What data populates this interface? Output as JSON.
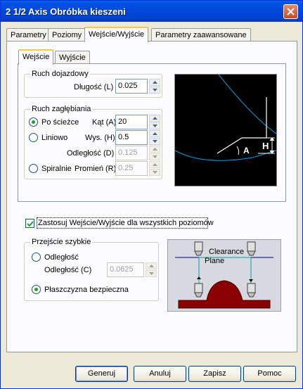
{
  "window": {
    "title": "2 1/2 Axis Obróbka kieszeni"
  },
  "tabs": [
    {
      "label": "Parametry"
    },
    {
      "label": "Poziomy"
    },
    {
      "label": "Wejście/Wyjście"
    },
    {
      "label": "Parametry zaawansowane"
    }
  ],
  "active_tab": "Wejście/Wyjście",
  "subtabs": [
    {
      "label": "Wejście"
    },
    {
      "label": "Wyjście"
    }
  ],
  "ruch_dojazdowy": {
    "title": "Ruch dojazdowy",
    "dlugosc_label": "Długość (L)",
    "dlugosc_value": "0.025"
  },
  "ruch_zaglebiania": {
    "title": "Ruch zagłębiania",
    "options": {
      "po_sciezce": "Po ścieżce",
      "liniowo": "Liniowo",
      "spiralnie": "Spiralnie"
    },
    "selected": "Po ścieżce",
    "kat_label": "Kąt (A)",
    "kat_value": "20",
    "wys_label": "Wys. (H)",
    "wys_value": "0.5",
    "odleglosc_label": "Odległość (D)",
    "odleglosc_value": "0.125",
    "promien_label": "Promień (R)",
    "promien_value": "0.25"
  },
  "diagram_labels": {
    "h": "H",
    "a": "A"
  },
  "apply_all": {
    "label": "Zastosuj Wejście/Wyjście dla wszystkich poziomów",
    "checked": true
  },
  "przejscie_szybkie": {
    "title": "Przejście szybkie",
    "opt_odleglosc": "Odległość",
    "odleglosc_c_label": "Odległość (C)",
    "odleglosc_c_value": "0.0625",
    "opt_plaszczyzna": "Płaszczyzna bezpieczna",
    "selected": "Płaszczyzna bezpieczna"
  },
  "clearance": {
    "line1": "Clearance",
    "line2": "Plane"
  },
  "buttons": {
    "generuj": "Generuj",
    "anuluj": "Anuluj",
    "zapisz": "Zapisz",
    "pomoc": "Pomoc"
  },
  "colors": {
    "title_bar": "#0054e3",
    "diagram_bg": "#000000",
    "diagram_curve": "#00a0e0",
    "stock": "#8b0000",
    "radio_dot": "#21a121"
  }
}
